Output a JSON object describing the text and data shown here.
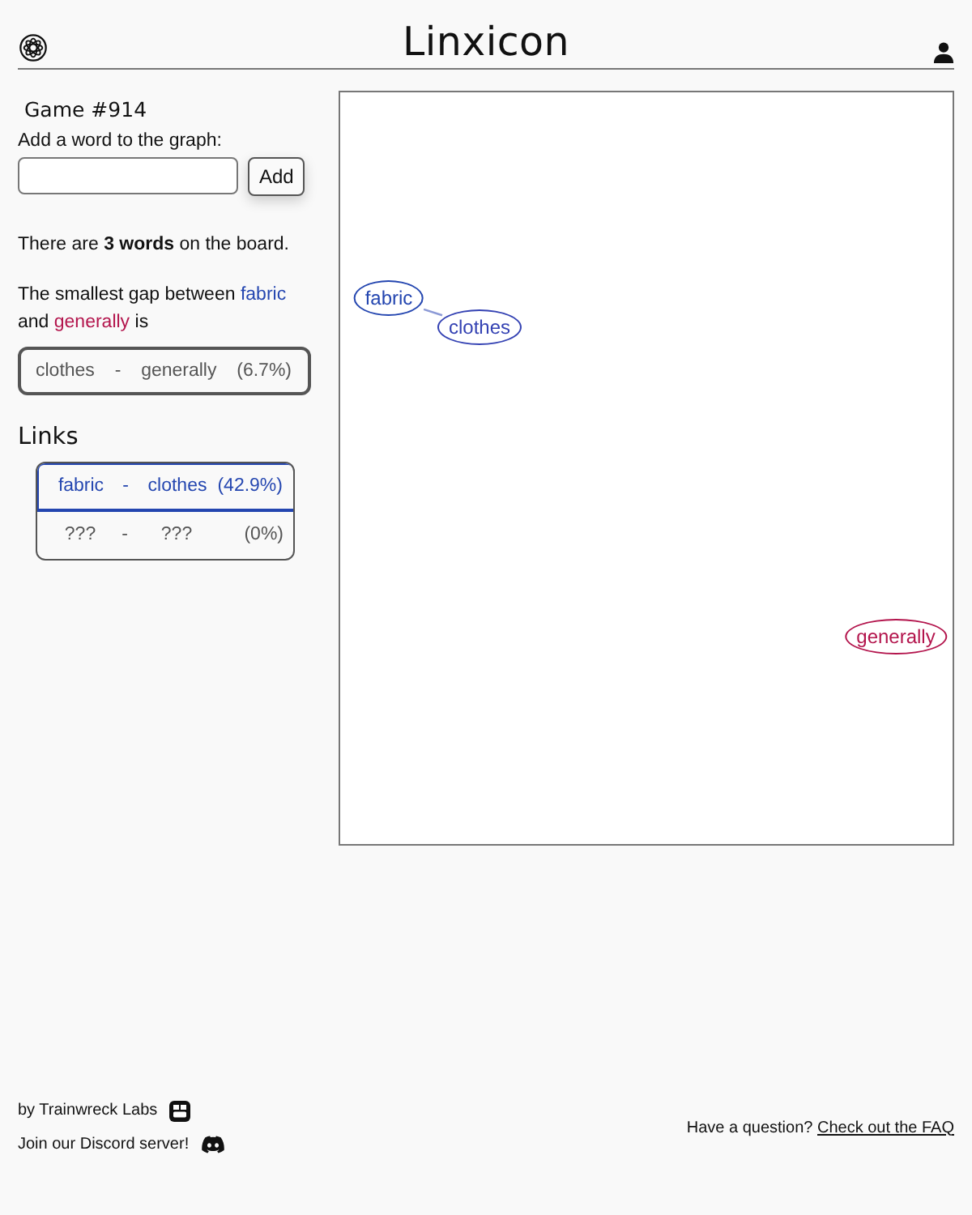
{
  "header": {
    "title": "Linxicon"
  },
  "game": {
    "title": "Game #914",
    "input_label": "Add a word to the graph:",
    "button": "Add"
  },
  "word_count_text": "There are **3 words** on the board.",
  "gap_sentence": {
    "before": "The smallest gap between",
    "words": [
      {
        "text": "fabric",
        "color": "#2446b0"
      },
      {
        "text": "generally",
        "color": "#b3144c"
      }
    ],
    "middle": "and",
    "after": "is"
  },
  "gap_pair": {
    "word_a": "clothes",
    "separator": "-",
    "word_b": "generally",
    "score": "(6.7%)"
  },
  "links": {
    "title": "Links",
    "rows": [
      {
        "word_a": "fabric",
        "separator": "-",
        "word_b": "clothes",
        "score": "(42.9%)",
        "found": true
      },
      {
        "word_a": "???",
        "separator": "-",
        "word_b": "???",
        "score": "(0%)",
        "found": false
      }
    ]
  },
  "graph": {
    "nodes": [
      {
        "label": "fabric",
        "color": "#2446b0",
        "children": [
          {
            "label": "clothes",
            "color": "#3442b3"
          }
        ]
      },
      {
        "label": "generally",
        "color": "#b3144c"
      }
    ]
  },
  "footer": {
    "credit": "by Trainwreck Labs",
    "discord": "Join our Discord server!",
    "faq_question": "Have a question?",
    "faq_link": "Check out the FAQ"
  }
}
